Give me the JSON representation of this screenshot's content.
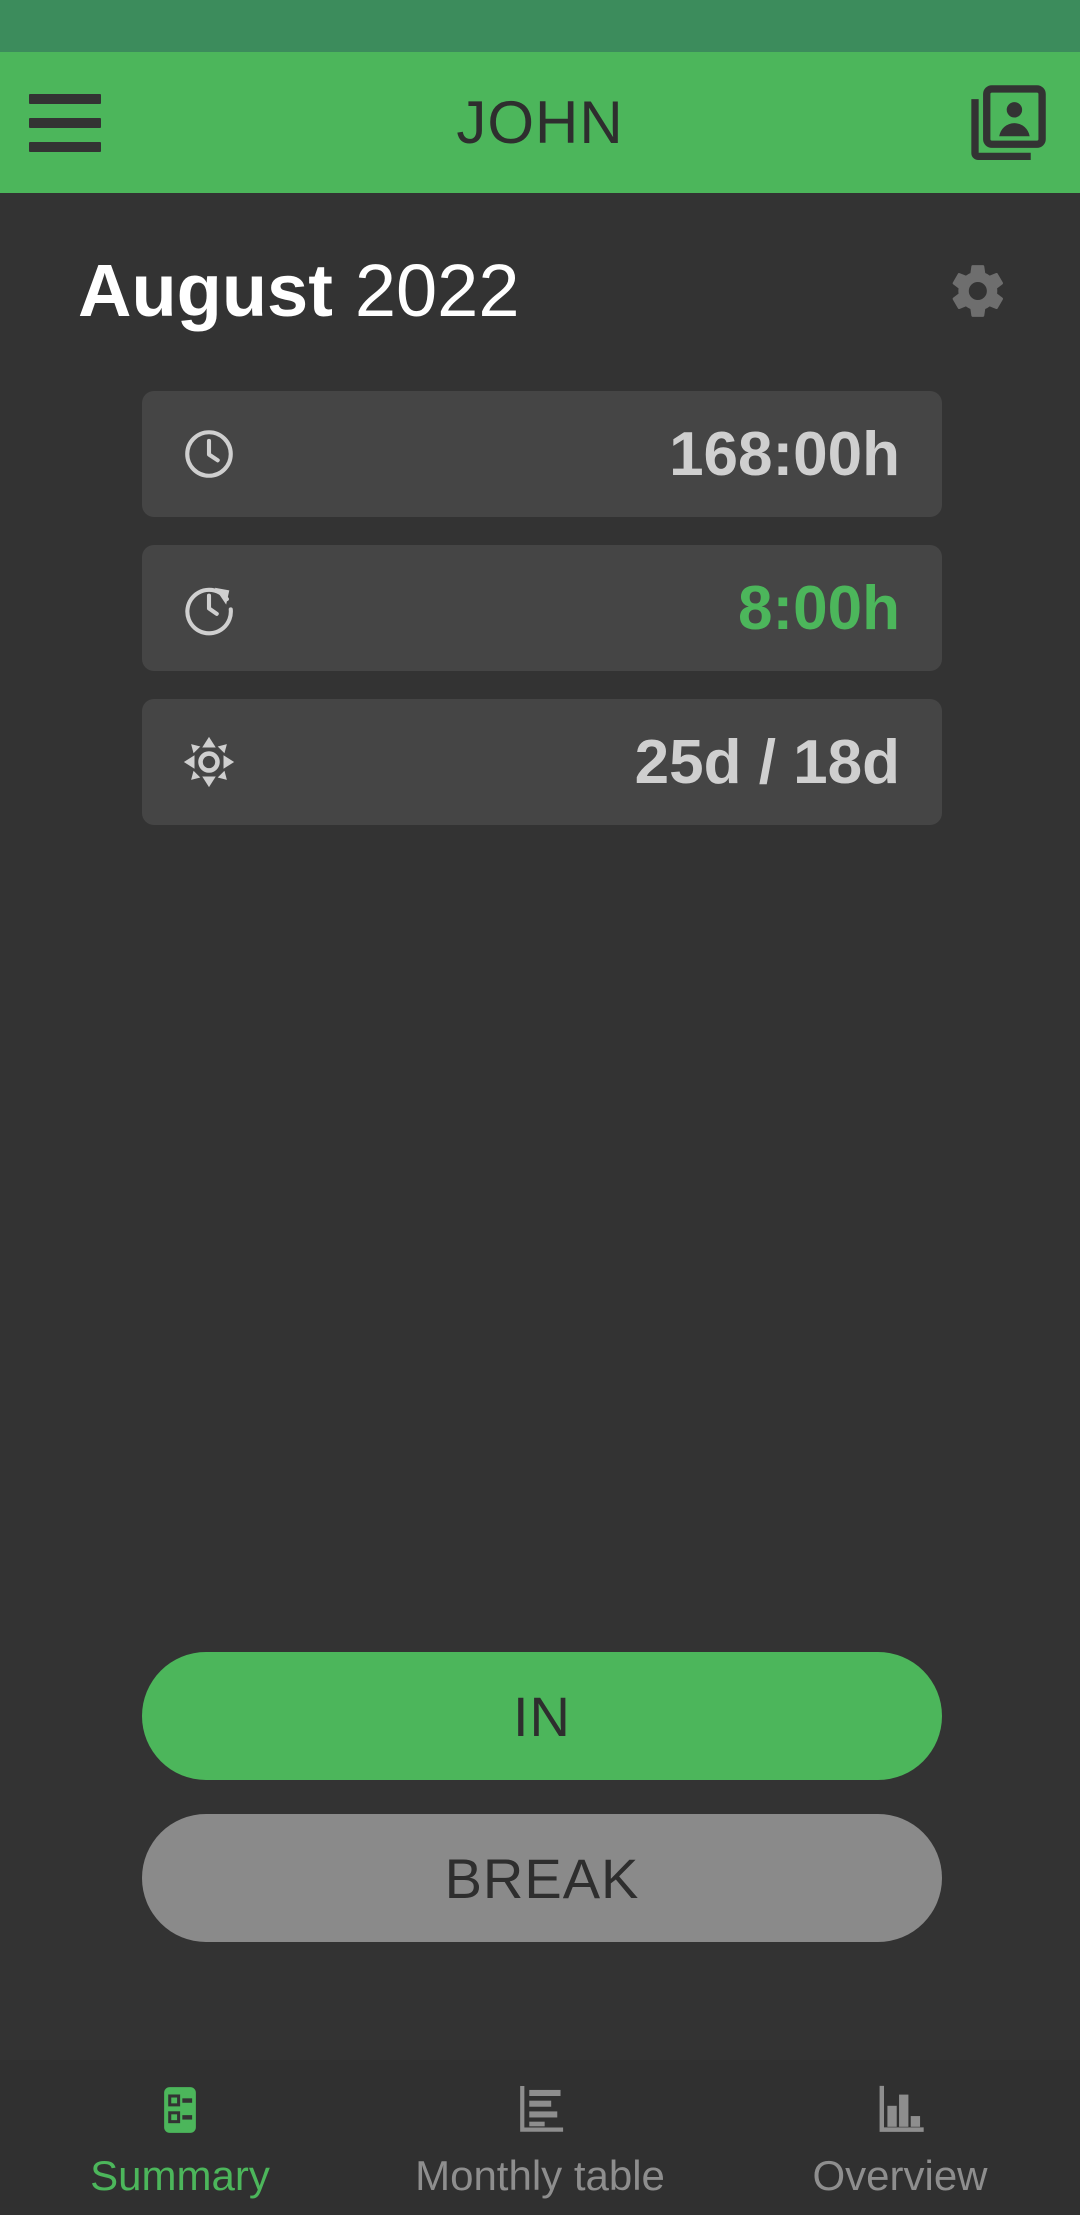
{
  "theme": {
    "accent": "#4CB65B",
    "accent_dark": "#3c8c5c",
    "background": "#333333",
    "card": "#454545",
    "text_primary": "#ffffff",
    "text_value": "#cfcfcf",
    "text_muted": "#8e8e8e",
    "button_secondary": "#8a8a8a",
    "on_accent": "#2e2e2e"
  },
  "app_bar": {
    "title": "JOHN",
    "menu_icon": "hamburger-menu-icon",
    "contacts_icon": "account-box-multiple-icon"
  },
  "header": {
    "month": "August",
    "year": "2022",
    "settings_icon": "gear-icon"
  },
  "stats": [
    {
      "icon": "clock-outline-icon",
      "label_value": "168:00h",
      "accent": false
    },
    {
      "icon": "clock-overtime-icon",
      "label_value": "8:00h",
      "accent": true
    },
    {
      "icon": "vacation-sun-icon",
      "label_value": "25d / 18d",
      "accent": false
    }
  ],
  "actions": {
    "in_label": "IN",
    "break_label": "BREAK"
  },
  "bottom_nav": {
    "items": [
      {
        "label": "Summary",
        "icon": "summary-list-icon",
        "active": true
      },
      {
        "label": "Monthly table",
        "icon": "table-chart-icon",
        "active": false
      },
      {
        "label": "Overview",
        "icon": "bar-chart-icon",
        "active": false
      }
    ]
  }
}
